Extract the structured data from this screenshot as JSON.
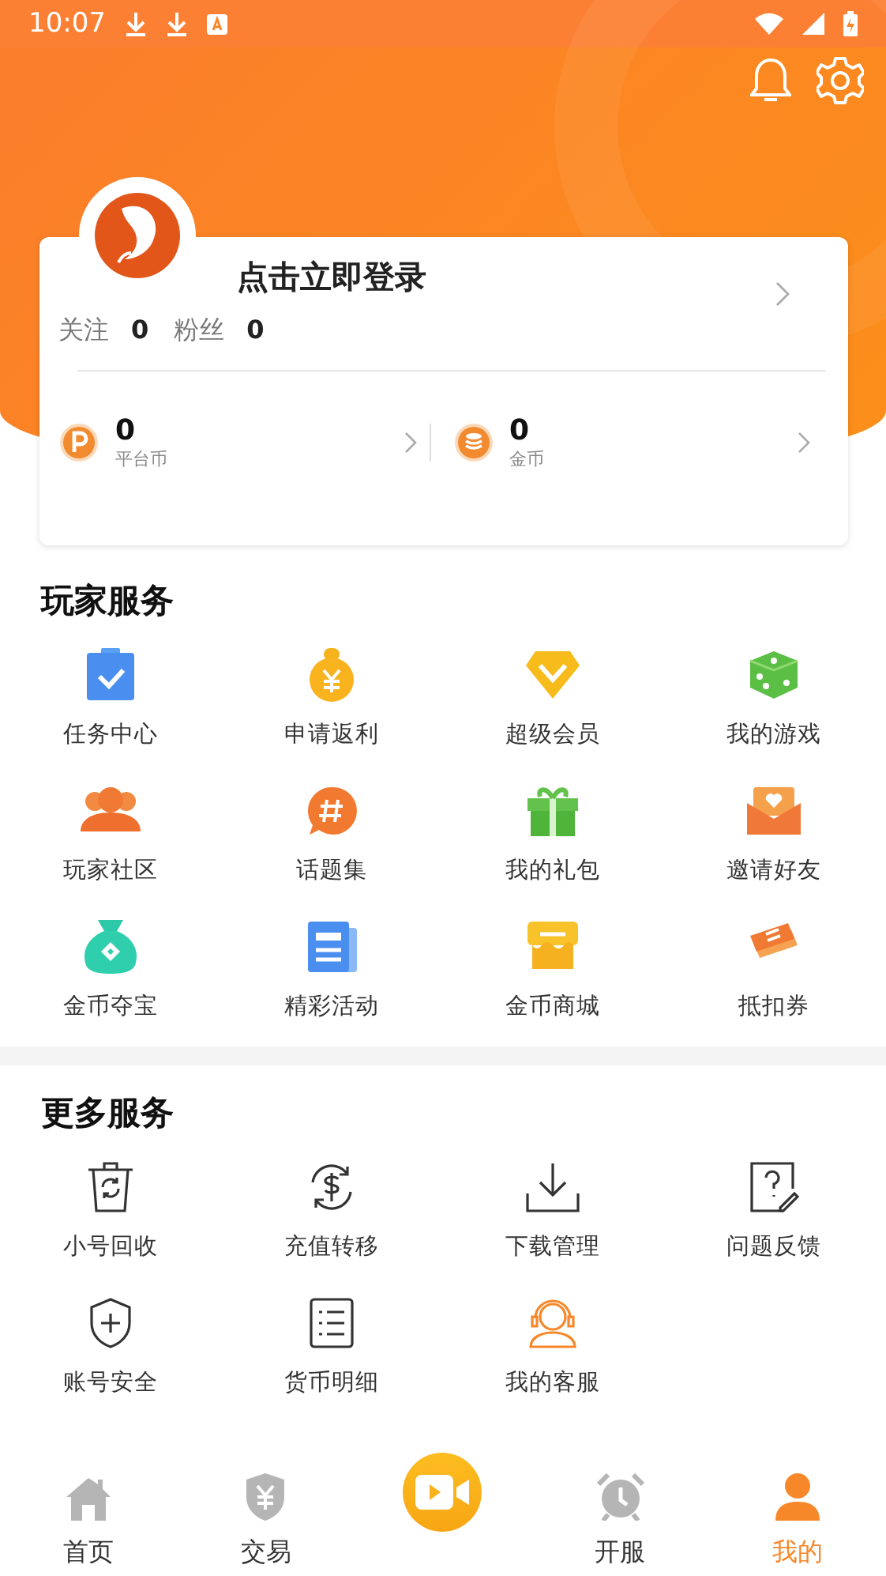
{
  "status_bar": {
    "time": "10:07"
  },
  "profile": {
    "login_prompt": "点击立即登录",
    "stats": [
      {
        "label": "关注",
        "value": "0"
      },
      {
        "label": "粉丝",
        "value": "0"
      }
    ],
    "currencies": [
      {
        "value": "0",
        "label": "平台币"
      },
      {
        "value": "0",
        "label": "金币"
      }
    ]
  },
  "player_services": {
    "title": "玩家服务",
    "items": [
      "任务中心",
      "申请返利",
      "超级会员",
      "我的游戏",
      "玩家社区",
      "话题集",
      "我的礼包",
      "邀请好友",
      "金币夺宝",
      "精彩活动",
      "金币商城",
      "抵扣券"
    ]
  },
  "more_services": {
    "title": "更多服务",
    "items": [
      "小号回收",
      "充值转移",
      "下载管理",
      "问题反馈",
      "账号安全",
      "货币明细",
      "我的客服"
    ]
  },
  "tab_bar": [
    {
      "kind": "tab",
      "label": "首页",
      "selected": false
    },
    {
      "kind": "tab",
      "label": "交易",
      "selected": false
    },
    {
      "kind": "center",
      "selected": false
    },
    {
      "kind": "tab",
      "label": "开服",
      "selected": false
    },
    {
      "kind": "tab",
      "label": "我的",
      "selected": true
    }
  ]
}
